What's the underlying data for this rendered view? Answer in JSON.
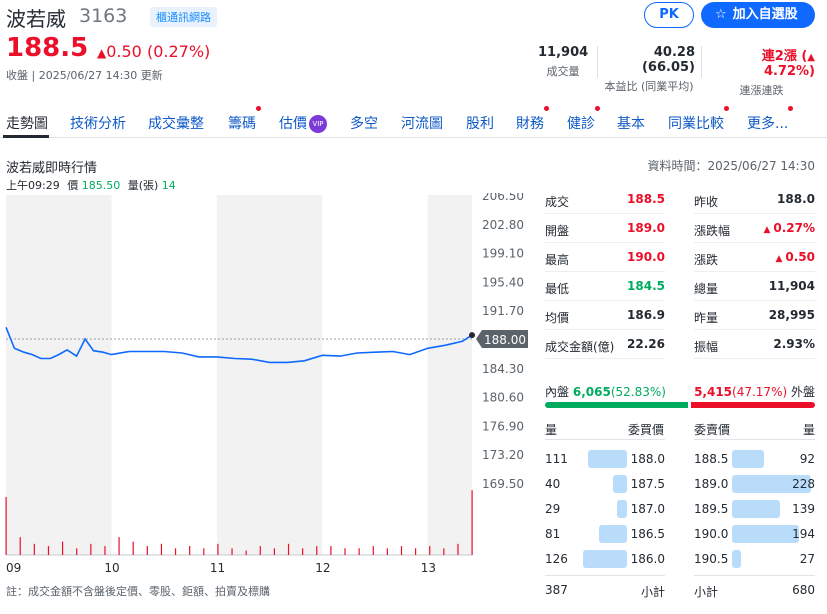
{
  "header": {
    "name": "波若威",
    "code": "3163",
    "industry": "櫃通訊網路",
    "pk_label": "PK",
    "watch_label": "加入自選股",
    "price": "188.5",
    "change": "0.50 (0.27%)",
    "close_info": "收盤 | 2025/06/27 14:30 更新",
    "volume": {
      "value": "11,904",
      "label": "成交量"
    },
    "pe": {
      "value": "40.28 (66.05)",
      "label": "本益比 (同業平均)"
    },
    "streak": {
      "value": "連2漲 (",
      "pct": "4.72%)",
      "label": "連漲連跌"
    }
  },
  "tabs": [
    {
      "label": "走勢圖",
      "dot": false,
      "vip": false
    },
    {
      "label": "技術分析",
      "dot": false,
      "vip": false
    },
    {
      "label": "成交彙整",
      "dot": false,
      "vip": false
    },
    {
      "label": "籌碼",
      "dot": true,
      "vip": false
    },
    {
      "label": "估價",
      "dot": false,
      "vip": true,
      "vip_text": "VIP"
    },
    {
      "label": "多空",
      "dot": false,
      "vip": false
    },
    {
      "label": "河流圖",
      "dot": false,
      "vip": false
    },
    {
      "label": "股利",
      "dot": false,
      "vip": false
    },
    {
      "label": "財務",
      "dot": true,
      "vip": false
    },
    {
      "label": "健診",
      "dot": true,
      "vip": false
    },
    {
      "label": "基本",
      "dot": false,
      "vip": false
    },
    {
      "label": "同業比較",
      "dot": true,
      "vip": false
    },
    {
      "label": "更多...",
      "dot": true,
      "vip": false
    }
  ],
  "realtime": {
    "title": "波若威即時行情",
    "data_time": "資料時間：2025/06/27 14:30",
    "info_time": "上午09:29",
    "info_price_label": "價",
    "info_price": "185.50",
    "info_vol_label": "量(張)",
    "info_vol": "14"
  },
  "chart_data": {
    "type": "line",
    "y_ticks": [
      "206.50",
      "202.80",
      "199.10",
      "195.40",
      "191.70",
      "188.00",
      "184.30",
      "180.60",
      "176.90",
      "173.20",
      "169.50"
    ],
    "x_ticks": [
      "09",
      "10",
      "11",
      "12",
      "13"
    ],
    "ylim": [
      169.5,
      206.5
    ],
    "reference_price": 188.0,
    "current_label": "188.00",
    "series": [
      {
        "x": [
          9.0,
          9.08,
          9.17,
          9.25,
          9.33,
          9.42,
          9.5,
          9.58,
          9.67,
          9.75,
          9.83,
          9.92,
          10.0,
          10.17,
          10.33,
          10.5,
          10.67,
          10.83,
          11.0,
          11.17,
          11.33,
          11.5,
          11.67,
          11.83,
          12.0,
          12.17,
          12.33,
          12.5,
          12.67,
          12.83,
          13.0,
          13.17,
          13.33,
          13.42
        ],
        "y": [
          189.5,
          186.8,
          186.3,
          186.0,
          185.5,
          185.5,
          186.0,
          186.6,
          185.8,
          188.0,
          186.5,
          186.3,
          186.0,
          186.4,
          186.4,
          186.4,
          186.2,
          185.7,
          185.7,
          185.5,
          185.4,
          185.0,
          185.0,
          185.2,
          185.9,
          185.8,
          186.2,
          186.3,
          186.4,
          186.0,
          186.8,
          187.2,
          187.7,
          188.5
        ]
      }
    ],
    "volume": [
      26,
      8,
      5,
      4,
      6,
      3,
      5,
      4,
      8,
      6,
      4,
      5,
      3,
      4,
      3,
      5,
      3,
      2,
      4,
      3,
      5,
      3,
      4,
      4,
      3,
      3,
      4,
      3,
      4,
      3,
      4,
      3,
      5,
      29
    ],
    "grid": true
  },
  "quote_left": [
    {
      "label": "成交",
      "value": "188.5",
      "color": "#eb0f29"
    },
    {
      "label": "開盤",
      "value": "189.0",
      "color": "#eb0f29"
    },
    {
      "label": "最高",
      "value": "190.0",
      "color": "#eb0f29"
    },
    {
      "label": "最低",
      "value": "184.5",
      "color": "#00ab5e"
    },
    {
      "label": "均價",
      "value": "186.9",
      "color": "#232a31"
    },
    {
      "label": "成交金額(億)",
      "value": "22.26",
      "color": "#232a31"
    }
  ],
  "quote_right": [
    {
      "label": "昨收",
      "value": "188.0",
      "color": "#232a31",
      "arrow": ""
    },
    {
      "label": "漲跌幅",
      "value": "0.27%",
      "color": "#eb0f29",
      "arrow": "▲"
    },
    {
      "label": "漲跌",
      "value": "0.50",
      "color": "#eb0f29",
      "arrow": "▲"
    },
    {
      "label": "總量",
      "value": "11,904",
      "color": "#232a31",
      "arrow": ""
    },
    {
      "label": "昨量",
      "value": "28,995",
      "color": "#232a31",
      "arrow": ""
    },
    {
      "label": "振幅",
      "value": "2.93%",
      "color": "#232a31",
      "arrow": ""
    }
  ],
  "inner": {
    "label": "內盤",
    "value": "6,065",
    "pct": "(52.83%)",
    "ratio": 0.5283
  },
  "outer": {
    "label": "外盤",
    "value": "5,415",
    "pct": "(47.17%)"
  },
  "bid_header": {
    "qty": "量",
    "price": "委買價"
  },
  "ask_header": {
    "price": "委賣價",
    "qty": "量"
  },
  "bids": [
    {
      "qty": "111",
      "price": "188.0",
      "level": 111
    },
    {
      "qty": "40",
      "price": "187.5",
      "level": 40
    },
    {
      "qty": "29",
      "price": "187.0",
      "level": 29
    },
    {
      "qty": "81",
      "price": "186.5",
      "level": 81
    },
    {
      "qty": "126",
      "price": "186.0",
      "level": 126
    }
  ],
  "asks": [
    {
      "price": "188.5",
      "qty": "92",
      "level": 92
    },
    {
      "price": "189.0",
      "qty": "228",
      "level": 228
    },
    {
      "price": "189.5",
      "qty": "139",
      "level": 139
    },
    {
      "price": "190.0",
      "qty": "194",
      "level": 194
    },
    {
      "price": "190.5",
      "qty": "27",
      "level": 27
    }
  ],
  "bid_total": {
    "qty": "387",
    "label": "小計"
  },
  "ask_total": {
    "label": "小計",
    "qty": "680"
  },
  "note": "註：成交金額不含盤後定價、零股、鉅額、拍賣及標購"
}
